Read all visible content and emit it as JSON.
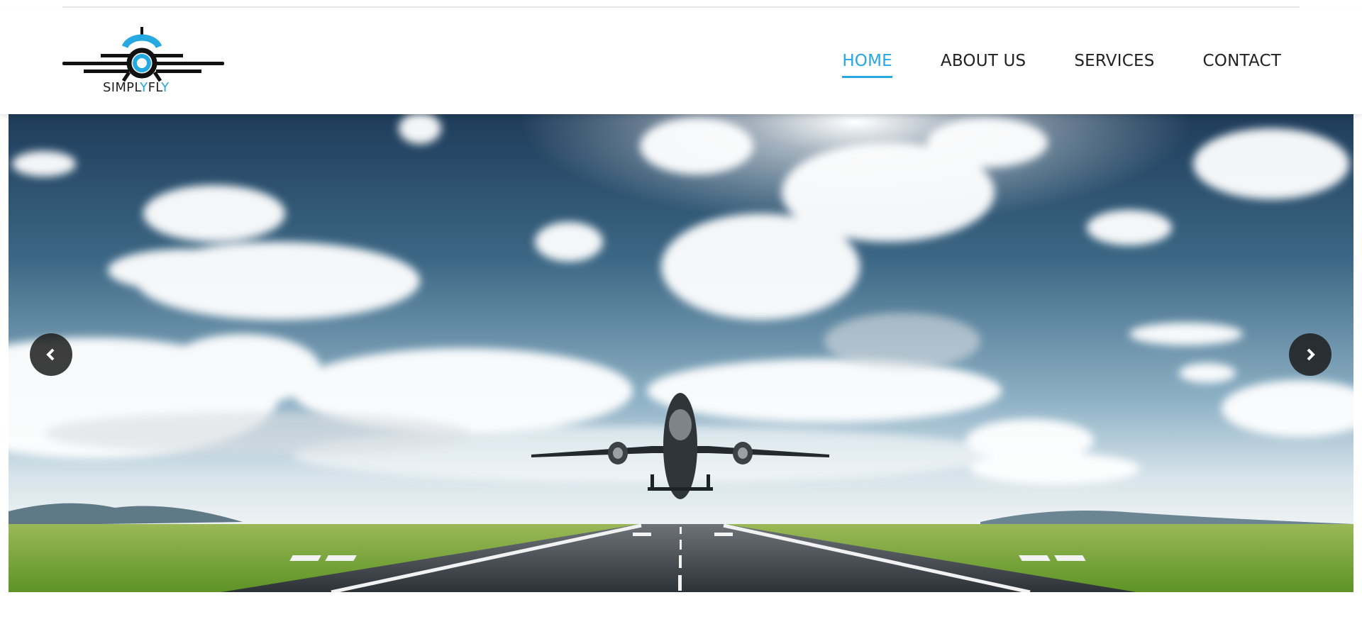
{
  "brand": {
    "name_part1": "SIMPL",
    "name_part2": "Y",
    "name_part3": "FL",
    "name_part4": "Y"
  },
  "nav": {
    "items": [
      {
        "label": "HOME",
        "active": true
      },
      {
        "label": "ABOUT US",
        "active": false
      },
      {
        "label": "SERVICES",
        "active": false
      },
      {
        "label": "CONTACT",
        "active": false
      }
    ]
  },
  "hero": {
    "image": "airplane-takeoff-runway",
    "prev_icon": "chevron-left-icon",
    "next_icon": "chevron-right-icon"
  },
  "colors": {
    "accent": "#25a9e0",
    "text": "#222222",
    "arrow_bg": "#1c1c1c"
  }
}
